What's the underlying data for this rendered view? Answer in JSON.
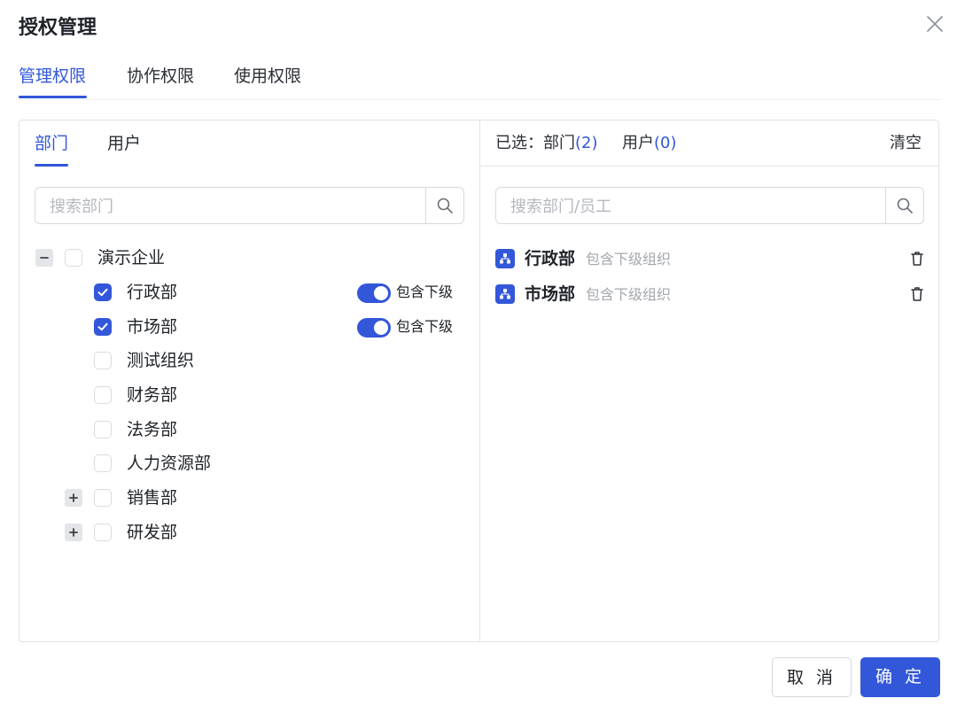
{
  "dialog": {
    "title": "授权管理"
  },
  "tabs": [
    {
      "label": "管理权限",
      "active": true
    },
    {
      "label": "协作权限",
      "active": false
    },
    {
      "label": "使用权限",
      "active": false
    }
  ],
  "left": {
    "tabs": [
      {
        "label": "部门",
        "active": true
      },
      {
        "label": "用户",
        "active": false
      }
    ],
    "search": {
      "placeholder": "搜索部门",
      "value": ""
    },
    "tree": {
      "root": {
        "label": "演示企业",
        "expanded": true,
        "checked": false
      },
      "children": [
        {
          "label": "行政部",
          "checked": true,
          "toggle": true,
          "toggle_label": "包含下级"
        },
        {
          "label": "市场部",
          "checked": true,
          "toggle": true,
          "toggle_label": "包含下级"
        },
        {
          "label": "测试组织",
          "checked": false
        },
        {
          "label": "财务部",
          "checked": false
        },
        {
          "label": "法务部",
          "checked": false
        },
        {
          "label": "人力资源部",
          "checked": false
        },
        {
          "label": "销售部",
          "checked": false,
          "expandable": true
        },
        {
          "label": "研发部",
          "checked": false,
          "expandable": true
        }
      ]
    }
  },
  "right": {
    "selected_label": "已选：部门",
    "dept_count": "(2)",
    "user_label": "用户",
    "user_count": "(0)",
    "clear_label": "清空",
    "search": {
      "placeholder": "搜索部门/员工",
      "value": ""
    },
    "items": [
      {
        "name": "行政部",
        "note": "包含下级组织"
      },
      {
        "name": "市场部",
        "note": "包含下级组织"
      }
    ]
  },
  "footer": {
    "cancel_label": "取 消",
    "ok_label": "确 定"
  },
  "colors": {
    "accent": "#3357d9",
    "border": "#dfe2e7",
    "muted_text": "#a4a8ae"
  },
  "icons": [
    "close-icon",
    "search-icon",
    "check-icon",
    "minus-icon",
    "plus-icon",
    "org-icon",
    "trash-icon"
  ]
}
